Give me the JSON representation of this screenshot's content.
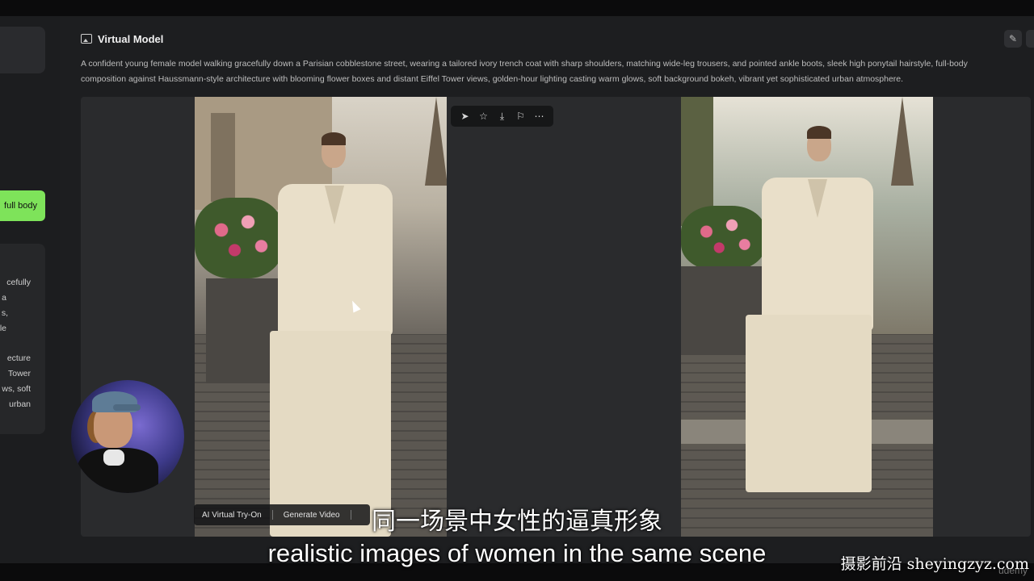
{
  "panel": {
    "title": "Virtual Model",
    "prompt": "A confident young female model walking gracefully down a Parisian cobblestone street, wearing a tailored ivory trench coat with sharp shoulders, matching wide-leg trousers, and pointed ankle boots, sleek high ponytail hairstyle, full-body composition against Haussmann-style architecture with blooming flower boxes and distant Eiffel Tower views, golden-hour lighting casting warm glows, soft background bokeh, vibrant yet sophisticated urban atmosphere."
  },
  "sidebar": {
    "green_button_label": "full body",
    "card_lines": [
      "cefully",
      "a",
      "s,",
      "le",
      "",
      "ecture",
      "Tower",
      "ws, soft",
      "urban"
    ]
  },
  "image_toolbar": {
    "icons": [
      "send-icon",
      "star-icon",
      "download-icon",
      "flag-icon",
      "more-icon"
    ]
  },
  "actions": {
    "try_on": "AI Virtual Try-On",
    "generate_video": "Generate Video"
  },
  "subtitles": {
    "chinese": "同一场景中女性的逼真形象",
    "english": "realistic images of women in the same scene"
  },
  "watermark": "摄影前沿 sheyingzyz.com",
  "brand": "udemy"
}
